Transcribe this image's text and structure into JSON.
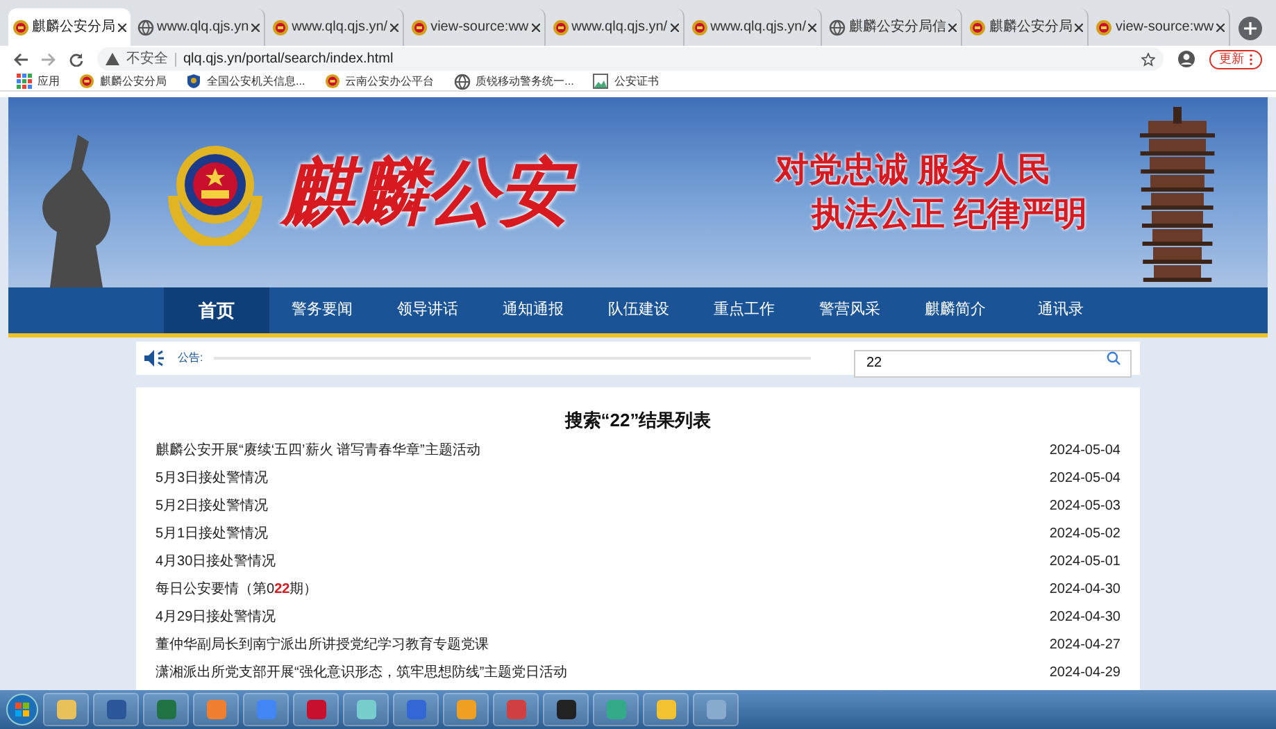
{
  "browser": {
    "tabs": [
      {
        "label": "麒麟公安分局",
        "kind": "emblem",
        "selected": true
      },
      {
        "label": "www.qlq.qjs.yn",
        "kind": "globe",
        "selected": false
      },
      {
        "label": "www.qlq.qjs.yn/",
        "kind": "emblem",
        "selected": false
      },
      {
        "label": "view-source:ww",
        "kind": "emblem",
        "selected": false
      },
      {
        "label": "www.qlq.qjs.yn/",
        "kind": "emblem",
        "selected": false
      },
      {
        "label": "www.qlq.qjs.yn/",
        "kind": "emblem",
        "selected": false
      },
      {
        "label": "麒麟公安分局信",
        "kind": "globe",
        "selected": false
      },
      {
        "label": "麒麟公安分局",
        "kind": "emblem",
        "selected": false
      },
      {
        "label": "view-source:ww",
        "kind": "emblem",
        "selected": false
      }
    ],
    "security": "不安全",
    "url": "qlq.qjs.yn/portal/search/index.html",
    "update_button": "更新",
    "bookmarks": [
      {
        "label": "应用",
        "kind": "apps"
      },
      {
        "label": "麒麟公安分局",
        "kind": "emblem"
      },
      {
        "label": "全国公安机关信息...",
        "kind": "badge"
      },
      {
        "label": "云南公安办公平台",
        "kind": "emblem"
      },
      {
        "label": "质锐移动警务统一...",
        "kind": "globe"
      },
      {
        "label": "公安证书",
        "kind": "image"
      }
    ]
  },
  "banner": {
    "title": "麒麟公安",
    "slogans": [
      "对党忠诚 服务人民",
      "执法公正 纪律严明"
    ]
  },
  "nav": [
    {
      "label": "首页",
      "selected": true
    },
    {
      "label": "警务要闻",
      "selected": false
    },
    {
      "label": "领导讲话",
      "selected": false
    },
    {
      "label": "通知通报",
      "selected": false
    },
    {
      "label": "队伍建设",
      "selected": false
    },
    {
      "label": "重点工作",
      "selected": false
    },
    {
      "label": "警营风采",
      "selected": false
    },
    {
      "label": "麒麟简介",
      "selected": false
    },
    {
      "label": "通讯录",
      "selected": false
    }
  ],
  "notice": {
    "label": "公告:"
  },
  "search": {
    "value": "22"
  },
  "results": {
    "title": "搜索“22”结果列表",
    "rows": [
      {
        "title": "麒麟公安开展“赓续‘五四’薪火 谱写青春华章”主题活动",
        "date": "2024-05-04"
      },
      {
        "title": "5月3日接处警情况",
        "date": "2024-05-04"
      },
      {
        "title": "5月2日接处警情况",
        "date": "2024-05-03"
      },
      {
        "title": "5月1日接处警情况",
        "date": "2024-05-02"
      },
      {
        "title": "4月30日接处警情况",
        "date": "2024-05-01"
      },
      {
        "title": "每日公安要情（第0**22**期）",
        "date": "2024-04-30"
      },
      {
        "title": "4月29日接处警情况",
        "date": "2024-04-30"
      },
      {
        "title": "董仲华副局长到南宁派出所讲授党纪学习教育专题党课",
        "date": "2024-04-27"
      },
      {
        "title": "潇湘派出所党支部开展“强化意识形态，筑牢思想防线”主题党日活动",
        "date": "2024-04-29"
      }
    ]
  }
}
